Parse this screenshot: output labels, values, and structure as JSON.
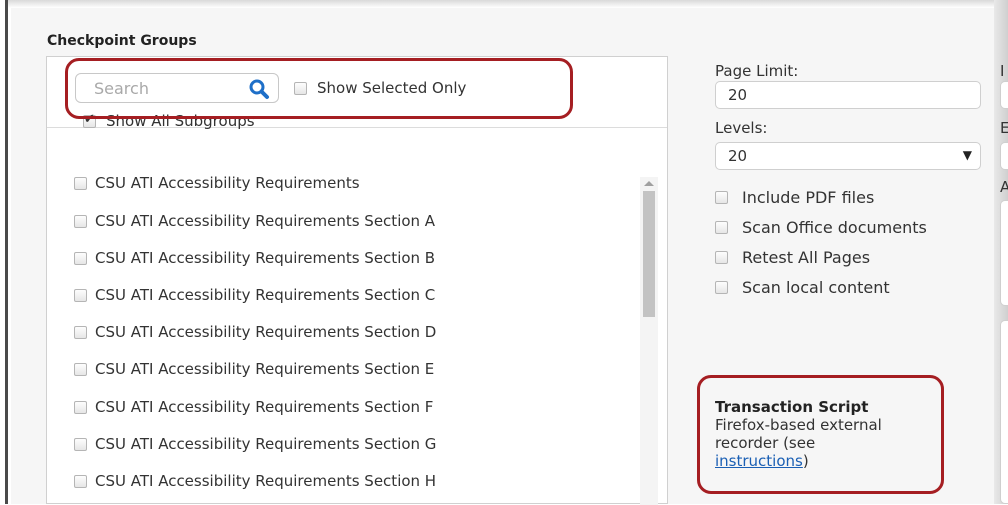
{
  "checkpoint_groups": {
    "title": "Checkpoint Groups",
    "search": {
      "placeholder": "Search",
      "value": ""
    },
    "show_selected_only": {
      "label": "Show Selected Only",
      "checked": false
    },
    "show_all_subgroups": {
      "label": "Show All Subgroups",
      "checked": true
    },
    "items": [
      {
        "label": "CSU ATI Accessibility Requirements",
        "checked": false
      },
      {
        "label": "CSU ATI Accessibility Requirements Section A",
        "checked": false
      },
      {
        "label": "CSU ATI Accessibility Requirements Section B",
        "checked": false
      },
      {
        "label": "CSU ATI Accessibility Requirements Section C",
        "checked": false
      },
      {
        "label": "CSU ATI Accessibility Requirements Section D",
        "checked": false
      },
      {
        "label": "CSU ATI Accessibility Requirements Section E",
        "checked": false
      },
      {
        "label": "CSU ATI Accessibility Requirements Section F",
        "checked": false
      },
      {
        "label": "CSU ATI Accessibility Requirements Section G",
        "checked": false
      },
      {
        "label": "CSU ATI Accessibility Requirements Section H",
        "checked": false
      }
    ]
  },
  "settings": {
    "page_limit": {
      "label": "Page Limit:",
      "value": "20"
    },
    "levels": {
      "label": "Levels:",
      "value": "20"
    },
    "options": [
      {
        "label": "Include PDF files",
        "checked": false
      },
      {
        "label": "Scan Office documents",
        "checked": false
      },
      {
        "label": "Retest All Pages",
        "checked": false
      },
      {
        "label": "Scan local content",
        "checked": false
      }
    ],
    "transaction_script": {
      "title": "Transaction Script",
      "description": "Firefox-based external recorder (see",
      "link": "instructions",
      "suffix": ")"
    },
    "partial_labels": [
      "I",
      "E",
      "A"
    ]
  },
  "colors": {
    "highlight": "#a51e22",
    "link": "#1a5fb4"
  }
}
